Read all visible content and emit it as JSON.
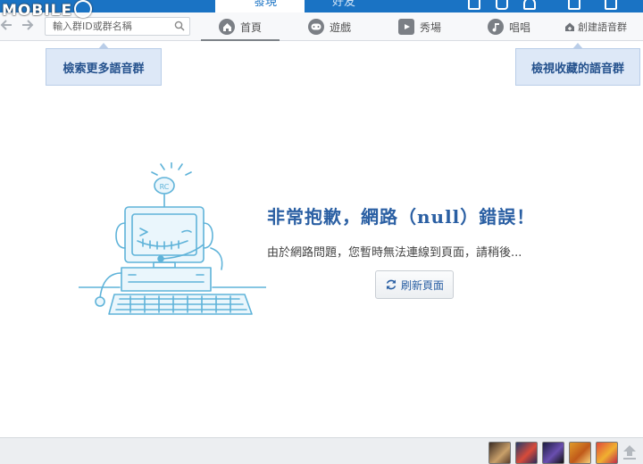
{
  "top_tabs": {
    "discover": "發現",
    "friends": "好友"
  },
  "watermark": {
    "text": "MOBILE"
  },
  "search": {
    "placeholder": "輸入群ID或群名稱"
  },
  "nav": {
    "items": [
      {
        "label": "首頁",
        "icon": "home-icon",
        "active": true
      },
      {
        "label": "遊戲",
        "icon": "gamepad-icon",
        "active": false
      },
      {
        "label": "秀場",
        "icon": "show-icon",
        "active": false
      },
      {
        "label": "唱唱",
        "icon": "music-note-icon",
        "active": false
      }
    ],
    "create_label": "創建語音群"
  },
  "tooltips": {
    "left": "檢索更多語音群",
    "right": "檢視收藏的語音群"
  },
  "illustration": {
    "badge_text": "RC"
  },
  "error": {
    "title": "非常抱歉，網路（null）錯誤！",
    "description": "由於網路問題，您暫時無法連線到頁面，請稍後...",
    "refresh_label": "刷新頁面"
  },
  "colors": {
    "brand_blue": "#1a73c4",
    "title_blue": "#2a5fa3",
    "tooltip_bg": "#dde8f7",
    "illustration_line": "#5fb3d9"
  },
  "bottom": {
    "game_icons": [
      "game-avatar-1",
      "game-avatar-2",
      "game-avatar-3",
      "game-avatar-4",
      "game-avatar-5"
    ]
  }
}
